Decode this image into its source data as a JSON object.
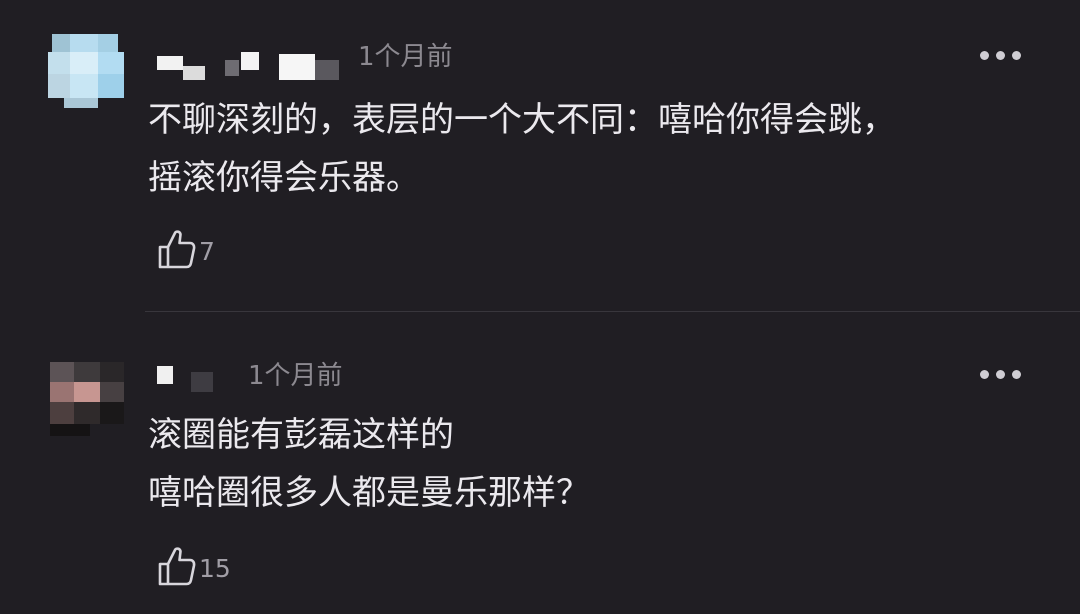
{
  "comments": [
    {
      "time": "1个月前",
      "lines": [
        "不聊深刻的，表层的一个大不同：嘻哈你得会跳，",
        "摇滚你得会乐器。"
      ],
      "likes": "7",
      "more_icon": "more-horizontal-icon",
      "like_icon": "thumbs-up-icon"
    },
    {
      "time": "1个月前",
      "lines": [
        "滚圈能有彭磊这样的",
        "嘻哈圈很多人都是曼乐那样？"
      ],
      "likes": "15",
      "more_icon": "more-horizontal-icon",
      "like_icon": "thumbs-up-icon"
    }
  ],
  "colors": {
    "background": "#201e23",
    "text": "#ebe9ee",
    "muted": "#8c8990",
    "divider": "#38363c"
  }
}
